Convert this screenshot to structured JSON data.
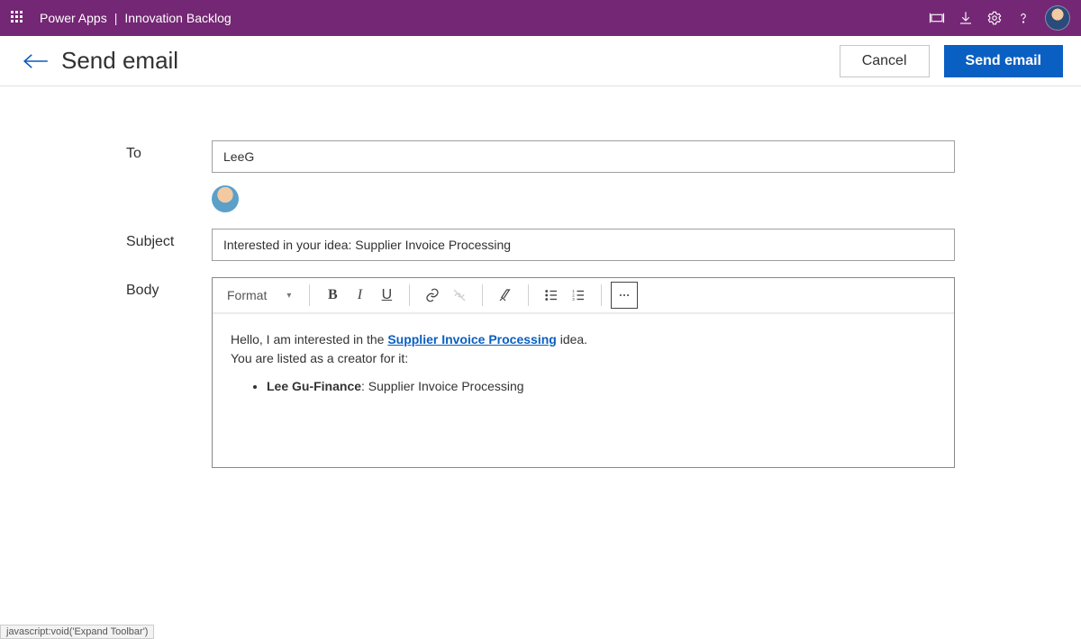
{
  "brand": {
    "product": "Power Apps",
    "app": "Innovation Backlog"
  },
  "header": {
    "title": "Send email",
    "cancel": "Cancel",
    "send": "Send email"
  },
  "form": {
    "to_label": "To",
    "to_value": "LeeG",
    "subject_label": "Subject",
    "subject_value": "Interested in your idea: Supplier Invoice Processing",
    "body_label": "Body"
  },
  "rte": {
    "format": "Format"
  },
  "body": {
    "line1_pre": "Hello, I am interested in the ",
    "line1_link": "Supplier Invoice Processing",
    "line1_post": " idea.",
    "line2": "You are listed as a creator for it:",
    "bullet_name": "Lee Gu-Finance",
    "bullet_rest": ": Supplier Invoice Processing"
  },
  "status": "javascript:void('Expand Toolbar')"
}
